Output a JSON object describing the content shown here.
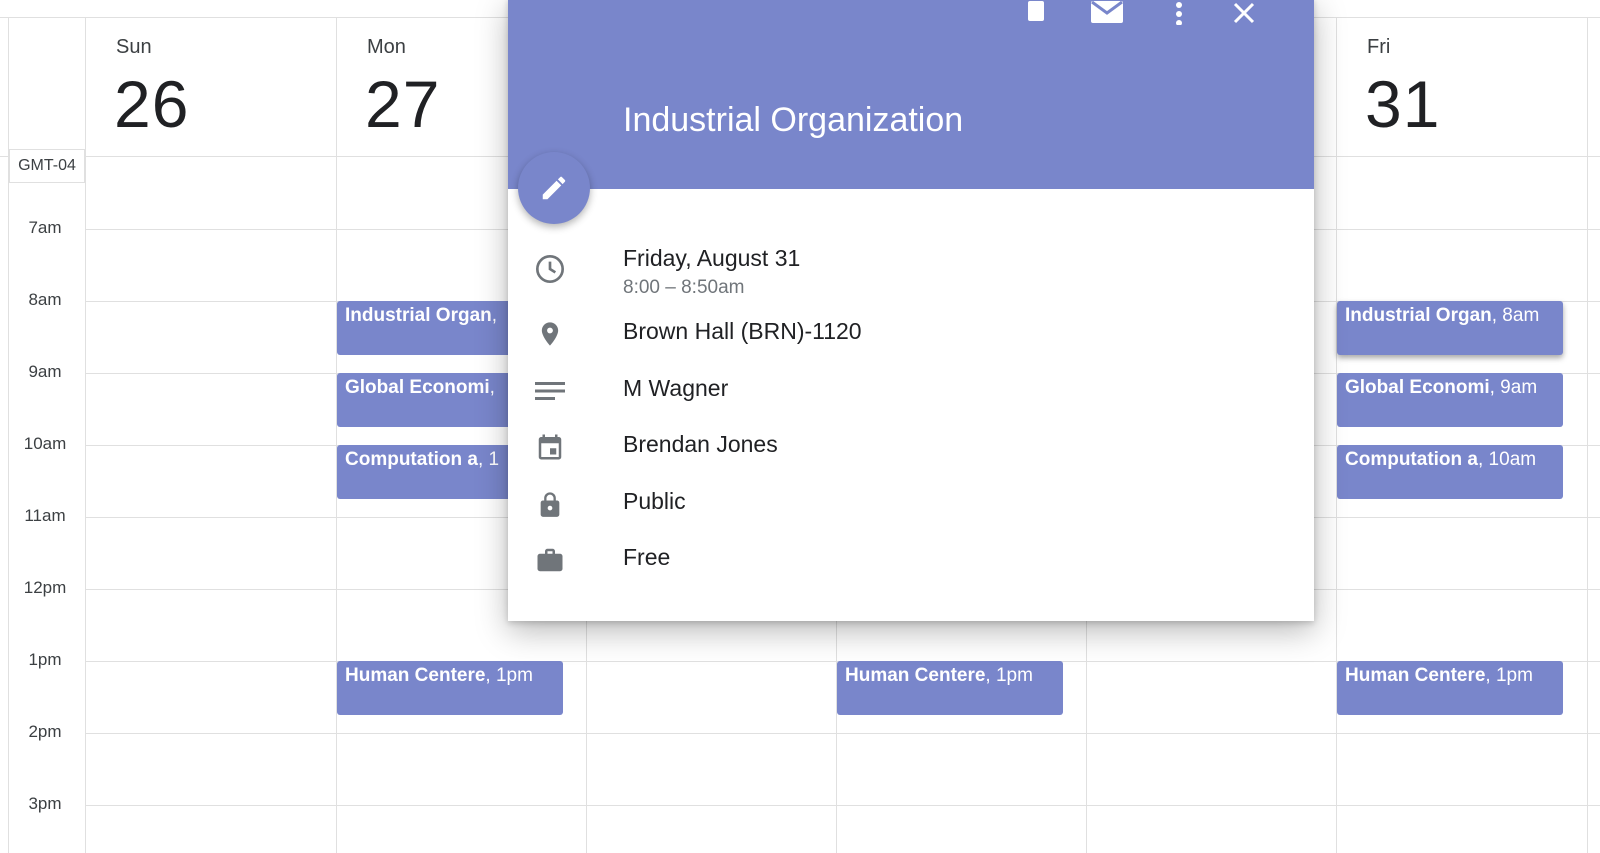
{
  "calendar": {
    "timezone": "GMT-04",
    "days": [
      {
        "name": "Sun",
        "number": "26"
      },
      {
        "name": "Mon",
        "number": "27"
      },
      {
        "name": "Fri",
        "number": "31"
      }
    ],
    "hours": [
      "7am",
      "8am",
      "9am",
      "10am",
      "11am",
      "12pm",
      "1pm",
      "2pm",
      "3pm"
    ],
    "events": {
      "mon": [
        {
          "title": "Industrial Organ",
          "time": ","
        },
        {
          "title": "Global Economi",
          "time": ","
        },
        {
          "title": "Computation a",
          "time": ", 1"
        },
        {
          "title": "Human Centere",
          "time": ", 1pm"
        }
      ],
      "wed": [
        {
          "title": "Human Centere",
          "time": ", 1pm"
        }
      ],
      "fri": [
        {
          "title": "Industrial Organ",
          "time": ", 8am"
        },
        {
          "title": "Global Economi",
          "time": ", 9am"
        },
        {
          "title": "Computation a",
          "time": ", 10am"
        },
        {
          "title": "Human Centere",
          "time": ", 1pm"
        }
      ]
    }
  },
  "popup": {
    "title": "Industrial Organization",
    "date": "Friday, August 31",
    "time_range": "8:00 – 8:50am",
    "location": "Brown Hall (BRN)-1120",
    "description": "M Wagner",
    "calendar_owner": "Brendan Jones",
    "visibility": "Public",
    "availability": "Free",
    "header_icons": [
      "delete-icon",
      "email-icon",
      "more-options-icon",
      "close-icon"
    ],
    "row_icons": [
      "clock-icon",
      "location-pin-icon",
      "description-icon",
      "calendar-icon",
      "lock-icon",
      "briefcase-icon"
    ]
  },
  "colors": {
    "event": "#7986cb",
    "grid": "#e0e0e0"
  }
}
